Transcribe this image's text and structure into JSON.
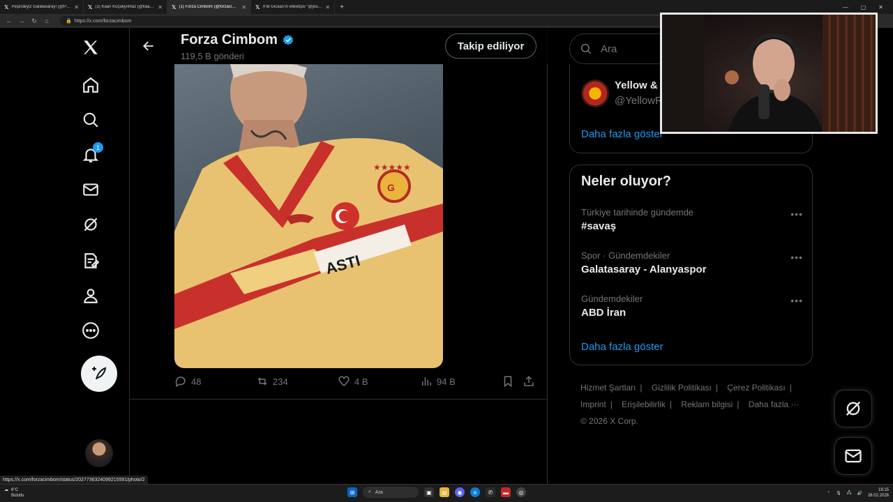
{
  "browser": {
    "tabs": [
      {
        "title": "Peşindeyiz Galatasaray! (@Pesindeyiz...",
        "active": false
      },
      {
        "title": "(1) Kaan Küçükyılmaz (@kaankcky...",
        "active": false
      },
      {
        "title": "(1) Forza Cimbom (@forzacimbom)",
        "active": true
      },
      {
        "title": "X'te Gicaas'ın etiketçisi \"@jouska...",
        "active": false
      }
    ],
    "url": "https://x.com/forzacimbom",
    "status_url": "https://x.com/forzacimbom/status/2027736324099215591/photo/2"
  },
  "nav": {
    "notifications_badge": "1"
  },
  "header": {
    "profile_name": "Forza Cimbom",
    "posts_count": "119,5 B gönderi",
    "follow_label": "Takip ediliyor"
  },
  "tweet": {
    "replies": "48",
    "reposts": "234",
    "likes": "4 B",
    "views": "94 B"
  },
  "sidebar": {
    "search_placeholder": "Ara",
    "who_to_follow": {
      "name": "Yellow & R",
      "handle": "@YellowR",
      "show_more": "Daha fazla göster"
    },
    "trends": {
      "title": "Neler oluyor?",
      "items": [
        {
          "meta": "Türkiye tarihinde gündemde",
          "name": "#savaş"
        },
        {
          "meta": "Spor · Gündemdekiler",
          "name": "Galatasaray - Alanyaspor"
        },
        {
          "meta": "Gündemdekiler",
          "name": "ABD İran"
        }
      ],
      "show_more": "Daha fazla göster"
    },
    "footer": {
      "links": [
        "Hizmet Şartları",
        "Gizlilik Politikası",
        "Çerez Politikası",
        "Imprint",
        "Erişilebilirlik",
        "Reklam bilgisi",
        "Daha fazla ···"
      ],
      "copyright": "© 2026 X Corp."
    }
  },
  "taskbar": {
    "weather_temp": "6°C",
    "weather_desc": "Bulutlu",
    "search_label": "Ara",
    "time": "18:15",
    "date": "28.02.2026"
  },
  "colors": {
    "accent": "#1d9bf0",
    "background": "#000000",
    "border": "#2f3336",
    "muted_text": "#71767b"
  }
}
